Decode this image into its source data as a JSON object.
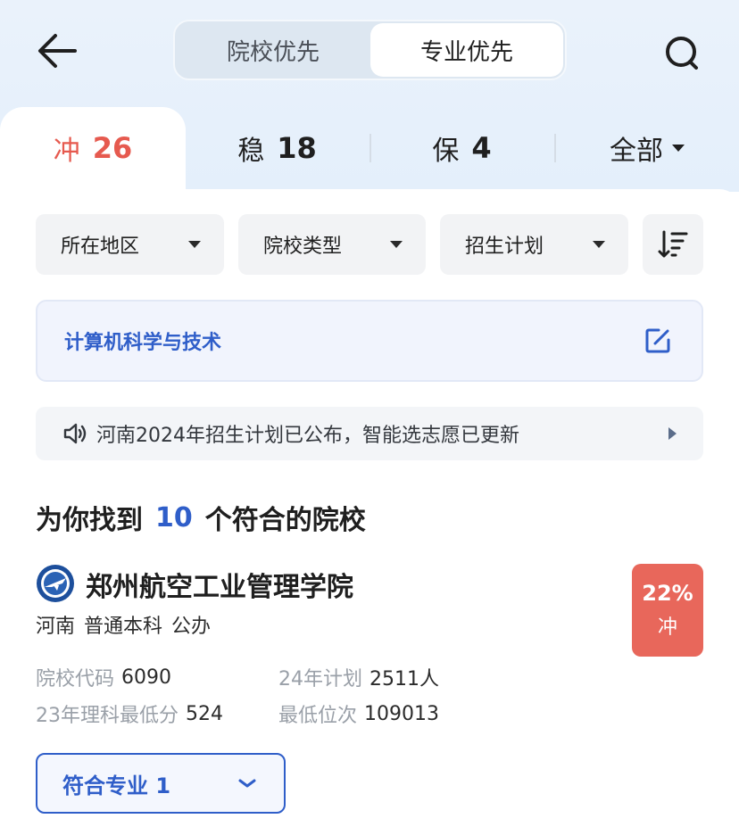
{
  "header": {
    "back_icon": "arrow-left-icon",
    "search_icon": "search-icon",
    "segments": [
      {
        "label": "院校优先",
        "selected": false
      },
      {
        "label": "专业优先",
        "selected": true
      }
    ]
  },
  "tabs": [
    {
      "label": "冲",
      "count": "26",
      "active": true
    },
    {
      "label": "稳",
      "count": "18",
      "active": false
    },
    {
      "label": "保",
      "count": "4",
      "active": false
    },
    {
      "label": "全部",
      "count": "",
      "active": false
    }
  ],
  "filters": [
    {
      "label": "所在地区"
    },
    {
      "label": "院校类型"
    },
    {
      "label": "招生计划"
    }
  ],
  "sort_icon": "sort-desc-icon",
  "major": {
    "label": "计算机科学与技术",
    "edit_icon": "edit-icon"
  },
  "notice": {
    "text": "河南2024年招生计划已公布，智能选志愿已更新",
    "icon": "speaker-icon"
  },
  "result": {
    "prefix": "为你找到",
    "count": "10",
    "suffix": "个符合的院校"
  },
  "school": {
    "name": "郑州航空工业管理学院",
    "tags": [
      "河南",
      "普通本科",
      "公办"
    ],
    "probability": "22%",
    "probability_label": "冲",
    "stats": {
      "code_label": "院校代码",
      "code_value": "6090",
      "plan_label": "24年计划",
      "plan_value": "2511人",
      "min_score_label": "23年理科最低分",
      "min_score_value": "524",
      "min_rank_label": "最低位次",
      "min_rank_value": "109013"
    },
    "match_button": "符合专业 1"
  },
  "colors": {
    "accent_blue": "#2f5ec9",
    "chong_red": "#e65a4f",
    "badge_red": "#e8675b",
    "header_bg": "#e7f0fb"
  }
}
